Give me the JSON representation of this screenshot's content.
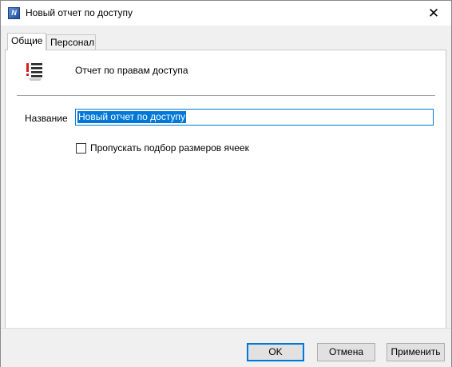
{
  "window": {
    "title": "Новый отчет по доступу",
    "close_glyph": "✕"
  },
  "tabs": [
    {
      "label": "Общие",
      "active": true
    },
    {
      "label": "Персонал",
      "active": false
    }
  ],
  "general": {
    "report_type": "Отчет по правам доступа",
    "report_icon": "list-report-icon",
    "name_label": "Название",
    "name_value": "Новый отчет по доступу",
    "skip_autosize_label": "Пропускать подбор размеров ячеек",
    "skip_autosize_checked": false
  },
  "buttons": {
    "ok": "OK",
    "cancel": "Отмена",
    "apply": "Применить"
  },
  "colors": {
    "accent": "#0078d7",
    "icon_red": "#d32020"
  }
}
